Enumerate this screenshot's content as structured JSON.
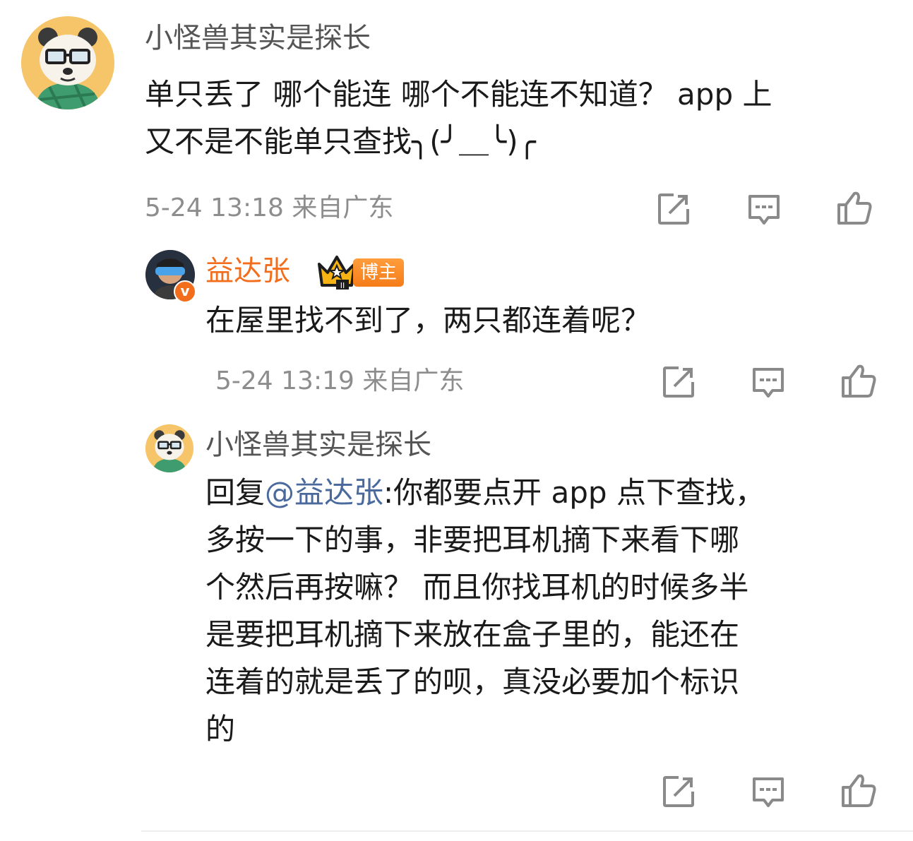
{
  "colors": {
    "username": "#555555",
    "blogger_name": "#f26d1c",
    "meta": "#8d8d8d",
    "mention": "#4a6a9e",
    "badge": "#f57c19",
    "text": "#1a1a1a"
  },
  "comment": {
    "username": "小怪兽其实是探长",
    "lines": [
      "单只丢了 哪个能连 哪个不能连不知道？ app 上",
      "又不是不能单只查找╮(╯＿╰)╭"
    ],
    "time": "5-24 13:18",
    "location": "来自广东",
    "icons": [
      "share-icon",
      "comment-icon",
      "like-icon"
    ]
  },
  "reply1": {
    "username": "益达张",
    "badge_label": "博主",
    "badge_level": "II",
    "verified_mark": "v",
    "text": "在屋里找不到了，两只都连着呢？",
    "time": "5-24 13:19",
    "location": "来自广东",
    "icons": [
      "share-icon",
      "comment-icon",
      "like-icon"
    ]
  },
  "reply2": {
    "username": "小怪兽其实是探长",
    "reply_prefix": "回复",
    "mention": "@益达张",
    "line1_rest": ":你都要点开 app 点下查找，",
    "lines": [
      "多按一下的事，非要把耳机摘下来看下哪",
      "个然后再按嘛？ 而且你找耳机的时候多半",
      "是要把耳机摘下来放在盒子里的，能还在",
      "连着的就是丢了的呗，真没必要加个标识",
      "的"
    ],
    "icons": [
      "share-icon",
      "comment-icon",
      "like-icon"
    ]
  }
}
